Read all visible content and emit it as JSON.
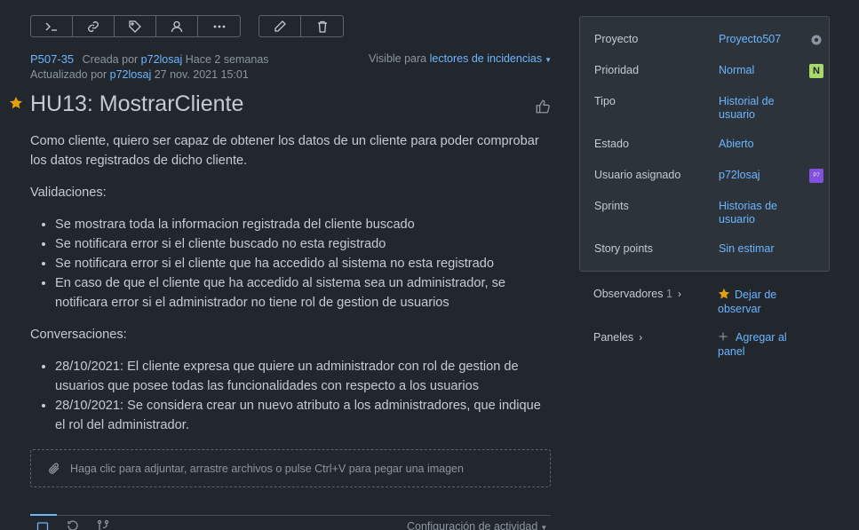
{
  "toolbar": {
    "left_buttons": [
      "terminal-icon",
      "link-icon",
      "tag-icon",
      "user-icon",
      "more-icon"
    ],
    "right_buttons": [
      "pencil-icon",
      "trash-icon"
    ]
  },
  "issue": {
    "key": "P507-35",
    "created_prefix": "Creada por",
    "created_by": "p72losaj",
    "created_when": "Hace 2 semanas",
    "updated_prefix": "Actualizado por",
    "updated_by": "p72losaj",
    "updated_when": "27 nov. 2021 15:01",
    "visible_prefix": "Visible para",
    "visible_to": "lectores de incidencias",
    "title": "HU13: MostrarCliente"
  },
  "description": {
    "intro": "Como cliente, quiero ser capaz de obtener los datos de un cliente para poder comprobar los datos registrados de dicho cliente.",
    "validations_heading": "Validaciones:",
    "validations": [
      "Se mostrara toda la informacion registrada del cliente buscado",
      "Se notificara error si el cliente buscado no esta registrado",
      "Se notificara error si el cliente que ha accedido al sistema no esta registrado",
      "En caso de que el cliente que ha accedido al sistema sea un administrador, se notificara error si el administrador no tiene rol de gestion de usuarios"
    ],
    "conversations_heading": "Conversaciones:",
    "conversations": [
      "28/10/2021: El cliente expresa que quiere un administrador con rol de gestion de usuarios que posee todas las funcionalidades con respecto a los usuarios",
      "28/10/2021: Se considera crear un nuevo atributo a los administradores, que indique el rol del administrador."
    ]
  },
  "attach": {
    "text": "Haga clic para adjuntar, arrastre archivos o pulse Ctrl+V para pegar una imagen"
  },
  "activity": {
    "config_label": "Configuración de actividad"
  },
  "fields": {
    "proyecto": {
      "label": "Proyecto",
      "value": "Proyecto507"
    },
    "prioridad": {
      "label": "Prioridad",
      "value": "Normal",
      "badge": "N"
    },
    "tipo": {
      "label": "Tipo",
      "value": "Historial de usuario"
    },
    "estado": {
      "label": "Estado",
      "value": "Abierto"
    },
    "asignado": {
      "label": "Usuario asignado",
      "value": "p72losaj",
      "avatar": "P7"
    },
    "sprints": {
      "label": "Sprints",
      "value": "Historias de usuario"
    },
    "story_points": {
      "label": "Story points",
      "value": "Sin estimar"
    }
  },
  "observers": {
    "label": "Observadores",
    "count": "1",
    "action": "Dejar de observar"
  },
  "boards": {
    "label": "Paneles",
    "action": "Agregar al panel"
  },
  "colors": {
    "background": "#22272e",
    "panel": "#2d333b",
    "link": "#6cb6ff",
    "star": "#e3a008",
    "priority_badge": "#a9d96b",
    "avatar": "#8250df"
  }
}
